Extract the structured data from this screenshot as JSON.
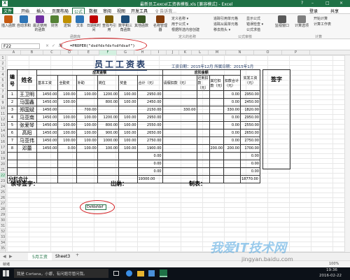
{
  "window": {
    "title": "最新员工excel工资表模板.xls [兼容模式] - Excel",
    "min": "–",
    "max": "□",
    "close": "×",
    "help": "?"
  },
  "menu": {
    "items": [
      "文件",
      "开始",
      "插入",
      "页面布局",
      "公式",
      "数据",
      "审阅",
      "视图",
      "开发工具"
    ],
    "active": 4,
    "tell": "♀ 告诉我...",
    "login": "登录",
    "share": "共享"
  },
  "ribbon": {
    "buttons": [
      {
        "label": "插入函数",
        "color": "#c55a11"
      },
      {
        "label": "自动求和",
        "color": "#2e75b6"
      },
      {
        "label": "最近使用的函数",
        "color": "#7030a0"
      },
      {
        "label": "财务",
        "color": "#548235"
      },
      {
        "label": "逻辑",
        "color": "#bf9000"
      },
      {
        "label": "文本",
        "color": "#2e75b6"
      },
      {
        "label": "日期和时间",
        "color": "#c00000"
      },
      {
        "label": "查找与引用",
        "color": "#7f6000"
      },
      {
        "label": "数学和三角函数",
        "color": "#1f4e79"
      },
      {
        "label": "其他函数",
        "color": "#375623"
      },
      {
        "label": "名称管理器",
        "color": "#833c0b"
      }
    ],
    "name_items": [
      "定义名称 ▾",
      "用于公式 ▾",
      "根据所选内容创建"
    ],
    "audit_items": [
      "追踪引用单元格",
      "追踪从属单元格",
      "移去箭头 ▾"
    ],
    "check_items": [
      "显示公式",
      "错误检查 ▾",
      "公式求值"
    ],
    "watch": "监视窗口",
    "calc_option": "计算选项",
    "calc_now": "开始计算",
    "calc_sheet": "计算工作表",
    "groups": [
      "函数库",
      "定义的名称",
      "公式审核",
      "计算"
    ]
  },
  "formula_bar": {
    "cell": "F22",
    "cancel": "×",
    "enter": "✓",
    "fx": "fx",
    "formula": "=PROPER(\"dsdfdsfdsfsdfdsaf\")"
  },
  "columns": [
    "A",
    "B",
    "C",
    "D",
    "E",
    "F",
    "G",
    "H",
    "I",
    "J",
    "K",
    "L",
    "M",
    "N",
    "O",
    "P"
  ],
  "rows": [
    "1",
    "2",
    "3",
    "4",
    "5",
    "6",
    "7",
    "8",
    "9",
    "10",
    "11",
    "12",
    "13",
    "14",
    "15",
    "16",
    "17",
    "18",
    "19",
    "20",
    "21",
    "22",
    "23",
    "24",
    "25",
    "26",
    "27",
    "28",
    "29",
    "30",
    "31",
    "32",
    "33",
    "34",
    "35"
  ],
  "payroll": {
    "title": "员工工资表",
    "date": "工资日期：2015年12月  所属日期：2015年1月",
    "h_no": "编号",
    "h_name": "姓名",
    "h_pay": "应发金额",
    "h_deduct": "应扣金额",
    "h_actual": "实发工资（元）",
    "h_sign": "签字",
    "sub": [
      "基本工资",
      "全勤奖",
      "补助",
      "岗位",
      "奖金",
      "合计（元）",
      "请假扣款（元）",
      "迟到扣款（元）",
      "其它扣款（元）",
      "扣款合计（元）"
    ],
    "rows": [
      [
        "1",
        "王卫明",
        "1450.00",
        "100.00",
        "100.00",
        "1200.00",
        "100.00",
        "2950.00",
        "",
        "",
        "",
        "0.00",
        "2950.00"
      ],
      [
        "2",
        "马国鑫",
        "1450.00",
        "100.00",
        "",
        "800.00",
        "100.00",
        "2450.00",
        "",
        "",
        "",
        "0.00",
        "2450.00"
      ],
      [
        "3",
        "郑国斌",
        "1450.00",
        "",
        "700.00",
        "",
        "",
        "2150.00",
        "330.00",
        "",
        "",
        "330.00",
        "1820.00"
      ],
      [
        "4",
        "马亚南",
        "1450.00",
        "100.00",
        "100.00",
        "1200.00",
        "100.00",
        "2950.00",
        "",
        "",
        "",
        "0.00",
        "2950.00"
      ],
      [
        "5",
        "张爱琴",
        "1450.00",
        "100.00",
        "100.00",
        "800.00",
        "100.00",
        "2550.00",
        "",
        "",
        "",
        "0.00",
        "2550.00"
      ],
      [
        "6",
        "高阳",
        "1450.00",
        "100.00",
        "100.00",
        "900.00",
        "100.00",
        "2650.00",
        "",
        "",
        "",
        "0.00",
        "2650.00"
      ],
      [
        "7",
        "马亚伟",
        "1450.00",
        "100.00",
        "100.00",
        "1000.00",
        "100.00",
        "2750.00",
        "",
        "",
        "",
        "0.00",
        "2750.00"
      ],
      [
        "8",
        "邓蕾",
        "1450.00",
        "0.00",
        "100.00",
        "100.00",
        "100.00",
        "1900.00",
        "",
        "",
        "200.00",
        "200.00",
        "1700.00"
      ],
      [
        "",
        "",
        "",
        "",
        "",
        "",
        "",
        "0.00",
        "",
        "",
        "",
        "",
        "0.00"
      ],
      [
        "",
        "",
        "",
        "",
        "",
        "",
        "",
        "0.00",
        "",
        "",
        "",
        "",
        "0.00"
      ],
      [
        "",
        "",
        "",
        "",
        "",
        "",
        "",
        "0.00",
        "",
        "",
        "",
        "",
        "0.00"
      ]
    ],
    "total_label": "分栏合计",
    "total_sum": "19300.00",
    "total_actual": "18770.00",
    "sig_leader": "领导签字：",
    "sig_cashier": "出纳：",
    "sig_maker": "制表："
  },
  "active_cell_value": "Dsfdsfdsf",
  "sheet_tabs": [
    "5月工资",
    "Sheet3"
  ],
  "add_sheet": "+",
  "status": {
    "ready": "就绪",
    "zoom": "100%"
  },
  "taskbar": {
    "search": "我是 Cortana，小娜，有问题尽管问我。",
    "time": "19:36",
    "date": "2016-02-22"
  },
  "watermark": {
    "main": "我爱IT技术网",
    "url": "jingyan.baidu.com"
  }
}
